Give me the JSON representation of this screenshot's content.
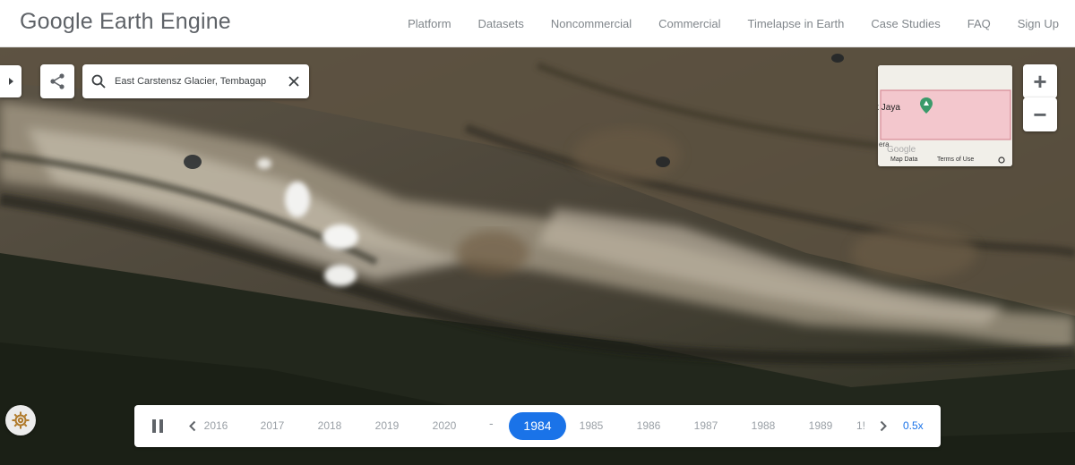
{
  "app": {
    "title": "Google Earth Engine"
  },
  "nav": {
    "items": [
      "Platform",
      "Datasets",
      "Noncommercial",
      "Commercial",
      "Timelapse in Earth",
      "Case Studies",
      "FAQ",
      "Sign Up"
    ]
  },
  "search": {
    "value": "East Carstensz Glacier, Tembagap"
  },
  "minimap": {
    "place_label": "k Jaya",
    "place_label2": "era",
    "google_logo": "Google",
    "map_data": "Map Data",
    "terms": "Terms of Use"
  },
  "zoom": {
    "in_label": "+",
    "out_label": "−"
  },
  "timeline": {
    "years_before": [
      "2016",
      "2017",
      "2018",
      "2019",
      "2020"
    ],
    "separator": "-",
    "selected_year": "1984",
    "years_after": [
      "1985",
      "1986",
      "1987",
      "1988",
      "1989",
      "1!"
    ],
    "speed": "0.5x"
  },
  "colors": {
    "accent": "#1a73e8",
    "minimap_highlight": "#f3c7cd"
  },
  "icons": [
    "chevron-right-icon",
    "share-icon",
    "search-icon",
    "close-icon",
    "pin-icon",
    "gear-icon",
    "pause-icon",
    "chevron-left-icon"
  ]
}
